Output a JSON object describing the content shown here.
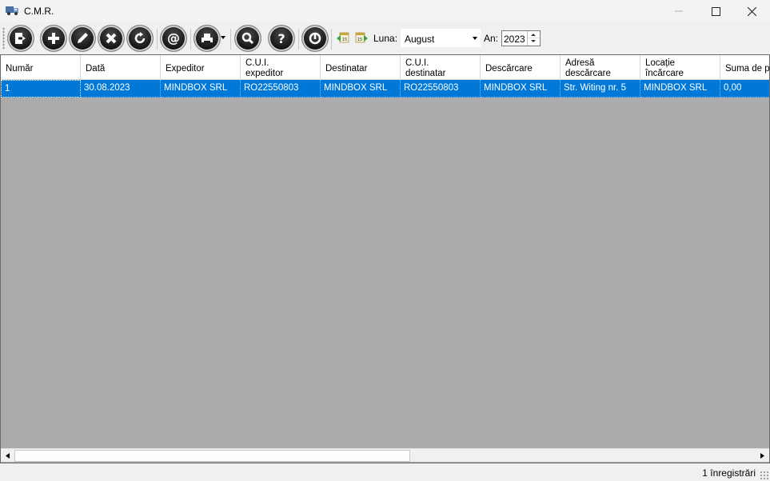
{
  "window": {
    "title": "C.M.R.",
    "icon": "truck-icon"
  },
  "toolbar": {
    "buttons": [
      {
        "name": "exit-button",
        "icon": "exit-door-icon"
      },
      {
        "name": "add-button",
        "icon": "plus-icon"
      },
      {
        "name": "edit-button",
        "icon": "pencil-icon"
      },
      {
        "name": "delete-button",
        "icon": "x-icon"
      },
      {
        "name": "refresh-button",
        "icon": "refresh-icon"
      },
      {
        "name": "email-button",
        "icon": "at-icon"
      },
      {
        "name": "print-button",
        "icon": "printer-icon"
      },
      {
        "name": "search-button",
        "icon": "magnifier-icon"
      },
      {
        "name": "help-button",
        "icon": "question-icon"
      },
      {
        "name": "power-button",
        "icon": "power-icon"
      }
    ],
    "luna_label": "Luna:",
    "luna_value": "August",
    "an_label": "An:",
    "an_value": "2023",
    "prev_period_icon": "prev-calendar-icon",
    "next_period_icon": "next-calendar-icon"
  },
  "grid": {
    "columns": [
      {
        "line1": "Număr",
        "line2": ""
      },
      {
        "line1": "Dată",
        "line2": ""
      },
      {
        "line1": "Expeditor",
        "line2": ""
      },
      {
        "line1": "C.U.I.",
        "line2": "expeditor"
      },
      {
        "line1": "Destinatar",
        "line2": ""
      },
      {
        "line1": "C.U.I.",
        "line2": "destinatar"
      },
      {
        "line1": "Descărcare",
        "line2": ""
      },
      {
        "line1": "Adresă",
        "line2": "descărcare"
      },
      {
        "line1": "Locație",
        "line2": "încărcare"
      },
      {
        "line1": "Suma de pl",
        "line2": ""
      }
    ],
    "rows": [
      [
        "1",
        "30.08.2023",
        "MINDBOX SRL",
        "RO22550803",
        "MINDBOX SRL",
        "RO22550803",
        "MINDBOX SRL",
        "Str. Witing nr. 5",
        "MINDBOX SRL",
        "0,00"
      ]
    ]
  },
  "status": {
    "record_count": "1 înregistrări"
  },
  "colors": {
    "selection": "#0078d7",
    "grid_background": "#ababab"
  }
}
